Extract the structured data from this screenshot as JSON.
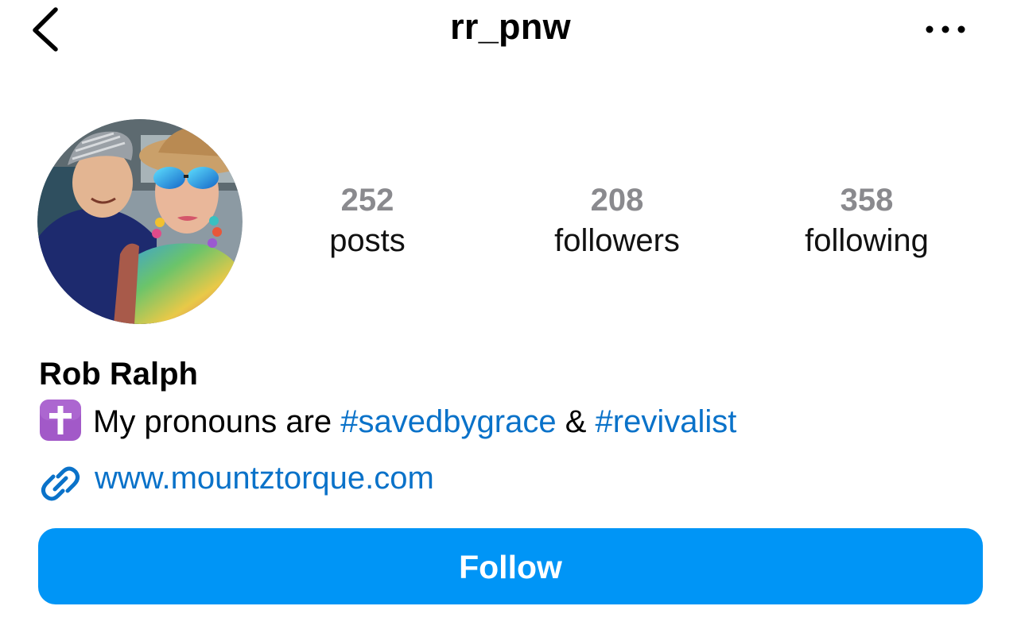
{
  "header": {
    "username": "rr_pnw",
    "back_icon": "chevron-left-icon",
    "more_icon": "more-horizontal-icon"
  },
  "profile": {
    "avatar_icon": "profile-photo",
    "stats": [
      {
        "count": "252",
        "label": "posts"
      },
      {
        "count": "208",
        "label": "followers"
      },
      {
        "count": "358",
        "label": "following"
      }
    ],
    "full_name": "Rob Ralph",
    "bio": {
      "emoji": "✝️",
      "text": "My pronouns are",
      "hashtag_1": "#savedbygrace",
      "joiner": "&",
      "hashtag_2": "#revivalist"
    },
    "link": {
      "icon": "link-icon",
      "text": "www.mountztorque.com"
    }
  },
  "actions": {
    "follow_label": "Follow"
  },
  "colors": {
    "accent": "#0095f6",
    "link": "#0a72c9",
    "stat_count": "#8a8a8e",
    "cross_emoji_bg": "#a259c8"
  }
}
